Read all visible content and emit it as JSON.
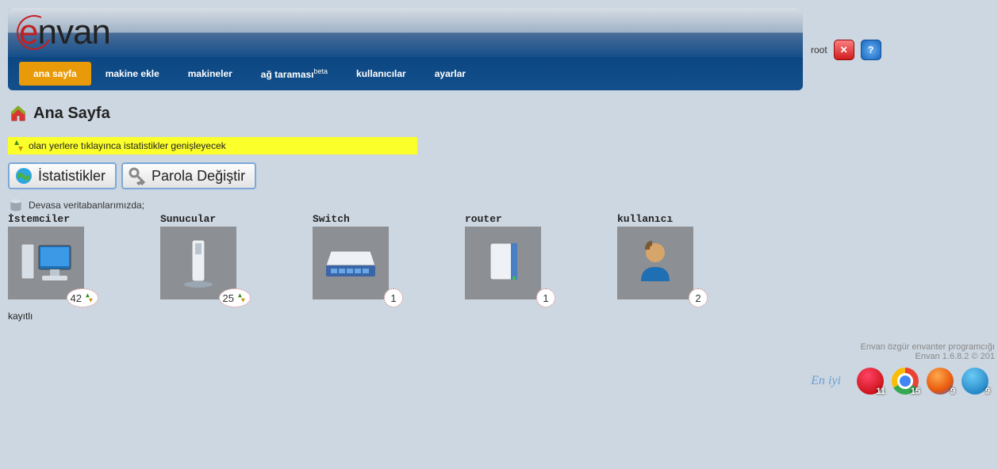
{
  "app": {
    "name": "envan"
  },
  "user": {
    "name": "root"
  },
  "nav": {
    "items": [
      {
        "label": "ana sayfa",
        "active": true
      },
      {
        "label": "makine ekle",
        "active": false
      },
      {
        "label": "makineler",
        "active": false
      },
      {
        "label": "ağ taraması",
        "sup": "beta",
        "active": false
      },
      {
        "label": "kullanıcılar",
        "active": false
      },
      {
        "label": "ayarlar",
        "active": false
      }
    ]
  },
  "page": {
    "title": "Ana Sayfa",
    "tip": "olan yerlere tıklayınca istatistikler genişleyecek",
    "db_line": "Devasa veritabanlarımızda;",
    "registered_label": "kayıtlı"
  },
  "tabs": [
    {
      "label": "İstatistikler"
    },
    {
      "label": "Parola Değiştir"
    }
  ],
  "stats": [
    {
      "key": "clients",
      "label": "İstemciler",
      "count": 42,
      "expandable": true
    },
    {
      "key": "servers",
      "label": "Sunucular",
      "count": 25,
      "expandable": true
    },
    {
      "key": "switch",
      "label": "Switch",
      "count": 1,
      "expandable": false
    },
    {
      "key": "router",
      "label": "router",
      "count": 1,
      "expandable": false
    },
    {
      "key": "user",
      "label": "kullanıcı",
      "count": 2,
      "expandable": false
    }
  ],
  "footer": {
    "line1": "Envan özgür envanter programcığı",
    "line2": "Envan 1.6.8.2 © 201",
    "best_with": "En iyi",
    "browsers": [
      {
        "name": "opera",
        "version": "11"
      },
      {
        "name": "chrome",
        "version": "15"
      },
      {
        "name": "firefox",
        "version": "9"
      },
      {
        "name": "ie",
        "version": "9"
      }
    ]
  }
}
